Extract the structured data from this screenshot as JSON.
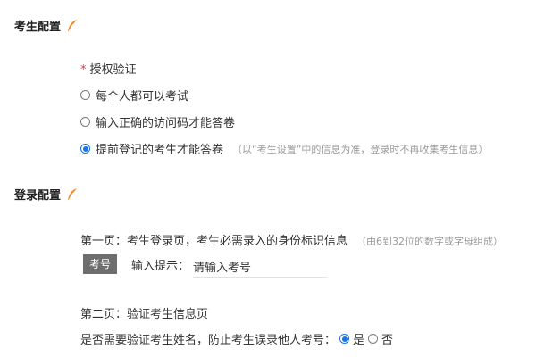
{
  "candidate_config": {
    "title": "考生配置",
    "auth": {
      "required_mark": "*",
      "label": "授权验证",
      "options": [
        {
          "label": "每个人都可以考试",
          "selected": false
        },
        {
          "label": "输入正确的访问码才能答卷",
          "selected": false
        },
        {
          "label": "提前登记的考生才能答卷",
          "selected": true,
          "note": "（以“考生设置”中的信息为准，登录时不再收集考生信息）"
        }
      ]
    }
  },
  "login_config": {
    "title": "登录配置",
    "page1": {
      "text": "第一页：考生登录页，考生必需录入的身份标识信息",
      "hint": "（由6到32位的数字或字母组成）",
      "badge": "考号",
      "input_label": "输入提示：",
      "input_value": "请输入考号"
    },
    "page2": {
      "text": "第二页：验证考生信息页",
      "question": "是否需要验证考生姓名，防止考生误录他人考号：",
      "yes_label": "是",
      "no_label": "否",
      "selected": "yes"
    }
  },
  "colors": {
    "accent": "#1a73e8",
    "required": "#e4393c",
    "feather": "#f08a24",
    "badge_bg": "#6e6e6e"
  }
}
